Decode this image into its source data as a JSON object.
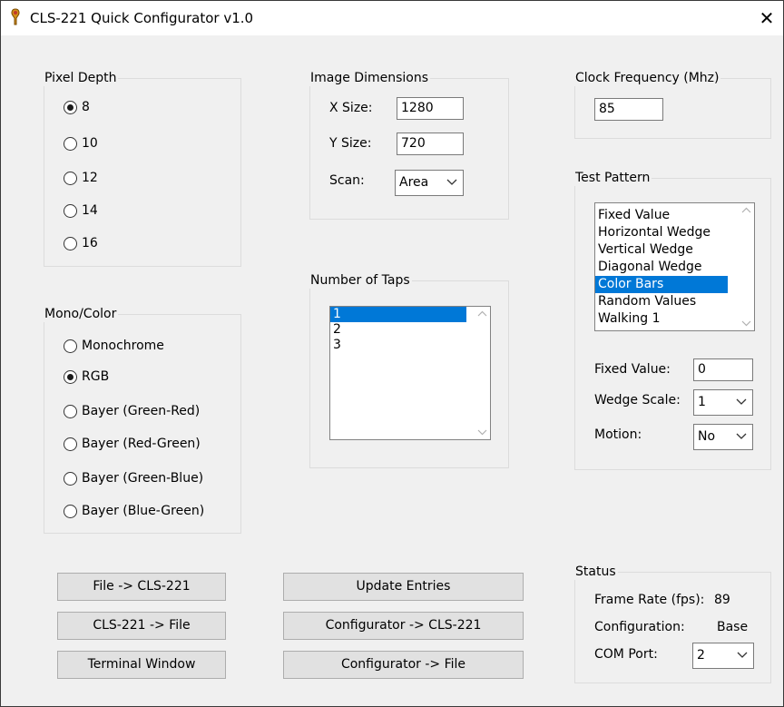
{
  "window": {
    "title": "CLS-221 Quick Configurator v1.0",
    "close_label": "✕"
  },
  "pixel_depth": {
    "title": "Pixel Depth",
    "options": [
      "8",
      "10",
      "12",
      "14",
      "16"
    ],
    "selected": "8"
  },
  "mono_color": {
    "title": "Mono/Color",
    "options": [
      "Monochrome",
      "RGB",
      "Bayer (Green-Red)",
      "Bayer (Red-Green)",
      "Bayer (Green-Blue)",
      "Bayer (Blue-Green)"
    ],
    "selected": "RGB"
  },
  "image_dimensions": {
    "title": "Image Dimensions",
    "x_label": "X Size:",
    "x_value": "1280",
    "y_label": "Y Size:",
    "y_value": "720",
    "scan_label": "Scan:",
    "scan_value": "Area"
  },
  "taps": {
    "title": "Number of Taps",
    "items": [
      "1",
      "2",
      "3"
    ],
    "selected": "1"
  },
  "clock": {
    "title": "Clock Frequency (Mhz)",
    "value": "85"
  },
  "test_pattern": {
    "title": "Test Pattern",
    "items": [
      "Fixed Value",
      "Horizontal Wedge",
      "Vertical Wedge",
      "Diagonal Wedge",
      "Color Bars",
      "Random Values",
      "Walking 1"
    ],
    "selected": "Color Bars",
    "fixed_value_label": "Fixed Value:",
    "fixed_value": "0",
    "wedge_scale_label": "Wedge Scale:",
    "wedge_scale": "1",
    "motion_label": "Motion:",
    "motion": "No"
  },
  "status": {
    "title": "Status",
    "frame_rate_label": "Frame Rate (fps):",
    "frame_rate": "89",
    "configuration_label": "Configuration:",
    "configuration": "Base",
    "com_port_label": "COM Port:",
    "com_port": "2"
  },
  "buttons": {
    "file_to_cls": "File -> CLS-221",
    "cls_to_file": "CLS-221 -> File",
    "terminal": "Terminal Window",
    "update": "Update Entries",
    "config_to_cls": "Configurator -> CLS-221",
    "config_to_file": "Configurator -> File"
  },
  "colors": {
    "selection": "#0078d7",
    "window_bg": "#f0f0f0",
    "button_bg": "#e1e1e1"
  }
}
